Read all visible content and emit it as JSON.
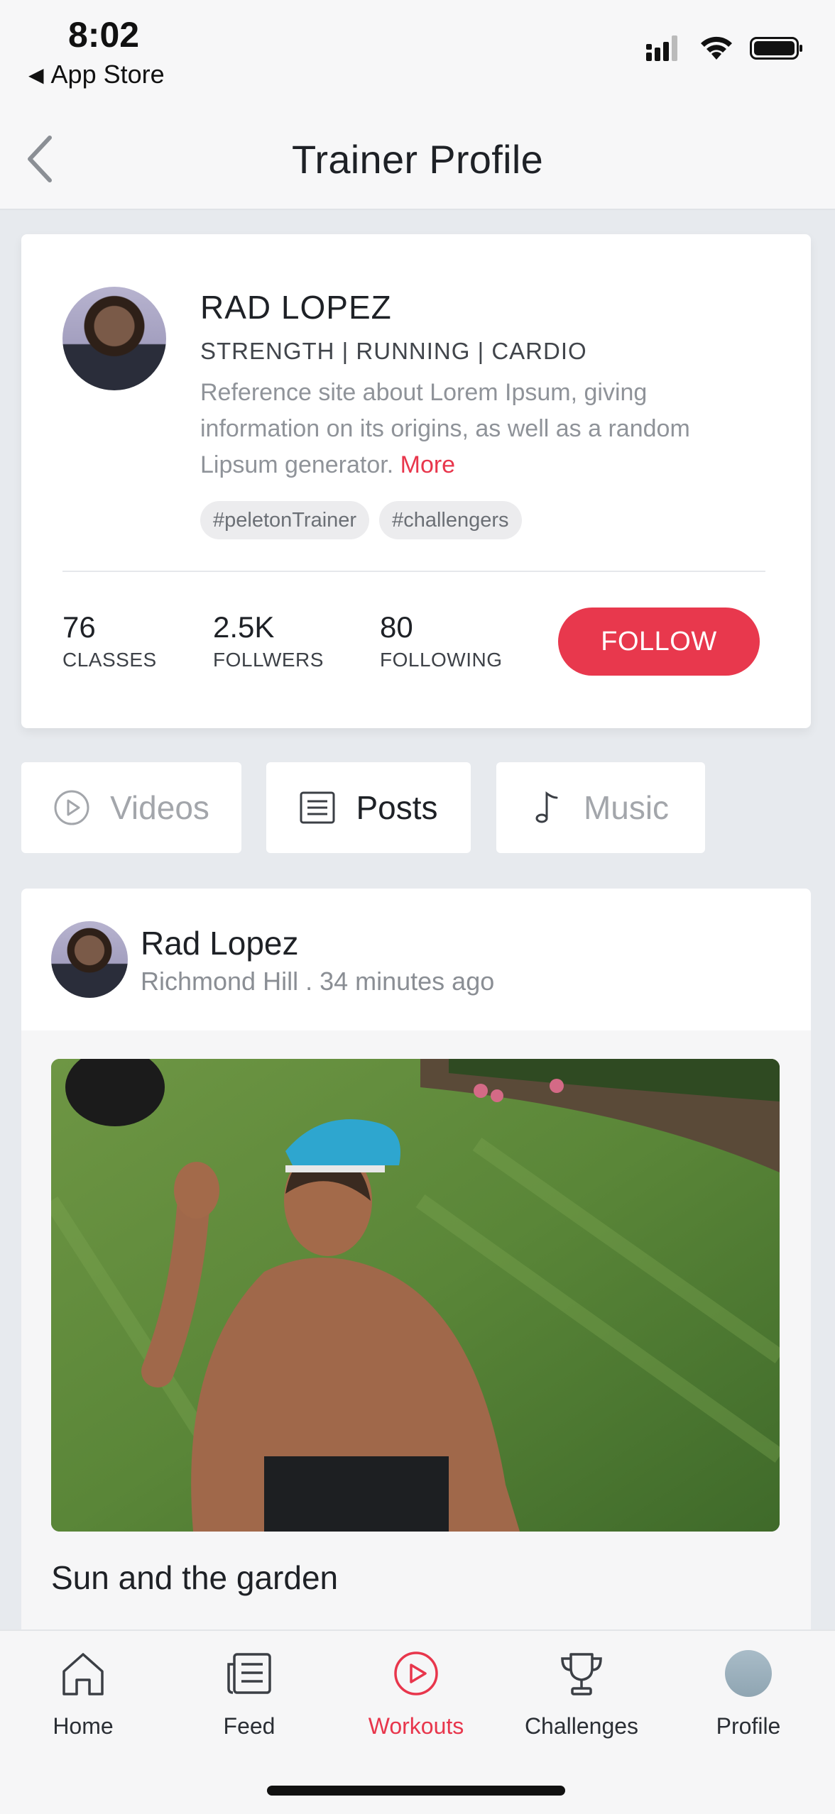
{
  "status_bar": {
    "time": "8:02",
    "back_label": "App Store"
  },
  "header": {
    "title": "Trainer Profile"
  },
  "trainer": {
    "name": "RAD LOPEZ",
    "disciplines": "STRENGTH | RUNNING | CARDIO",
    "bio": "Reference site about Lorem Ipsum, giving information on its origins, as well as a random Lipsum generator.",
    "more_label": "More",
    "hashtags": [
      "#peletonTrainer",
      "#challengers"
    ],
    "stats": [
      {
        "value": "76",
        "label": "CLASSES"
      },
      {
        "value": "2.5K",
        "label": "FOLLWERS"
      },
      {
        "value": "80",
        "label": "FOLLOWING"
      }
    ],
    "follow_label": "FOLLOW"
  },
  "tabs": [
    {
      "label": "Videos",
      "icon": "play-circle-icon",
      "active": false
    },
    {
      "label": "Posts",
      "icon": "document-icon",
      "active": true
    },
    {
      "label": "Music",
      "icon": "music-note-icon",
      "active": false
    }
  ],
  "post": {
    "author": "Rad Lopez",
    "meta": "Richmond Hill . 34 minutes ago",
    "title": "Sun and the garden"
  },
  "bottom_nav": [
    {
      "label": "Home",
      "icon": "home-icon",
      "active": false
    },
    {
      "label": "Feed",
      "icon": "feed-icon",
      "active": false
    },
    {
      "label": "Workouts",
      "icon": "play-circle-icon",
      "active": true
    },
    {
      "label": "Challenges",
      "icon": "trophy-icon",
      "active": false
    },
    {
      "label": "Profile",
      "icon": "avatar-icon",
      "active": false
    }
  ],
  "colors": {
    "accent": "#e8384d",
    "background": "#e7eaee",
    "card": "#ffffff"
  }
}
